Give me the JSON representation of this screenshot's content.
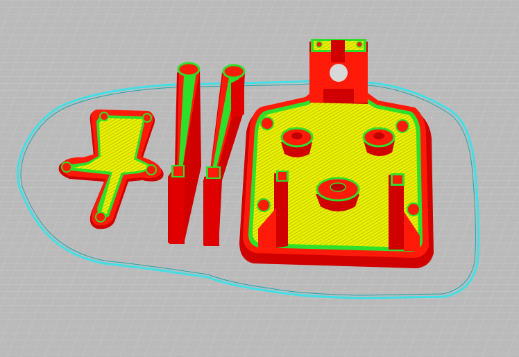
{
  "view": {
    "mode": "layer-preview",
    "colors": {
      "background": "#bcbcbc",
      "grid": "#c8c8c8",
      "skirt": "#3fe0e6",
      "wall_outer": "#ff1a0a",
      "wall_inner": "#2ee02a",
      "infill": "#e8f000",
      "shadow": "#d00000"
    }
  },
  "parts": [
    {
      "id": "plate-bracket"
    },
    {
      "id": "arm-left"
    },
    {
      "id": "arm-right"
    },
    {
      "id": "motor-mount-plate"
    },
    {
      "id": "top-clamp"
    }
  ]
}
